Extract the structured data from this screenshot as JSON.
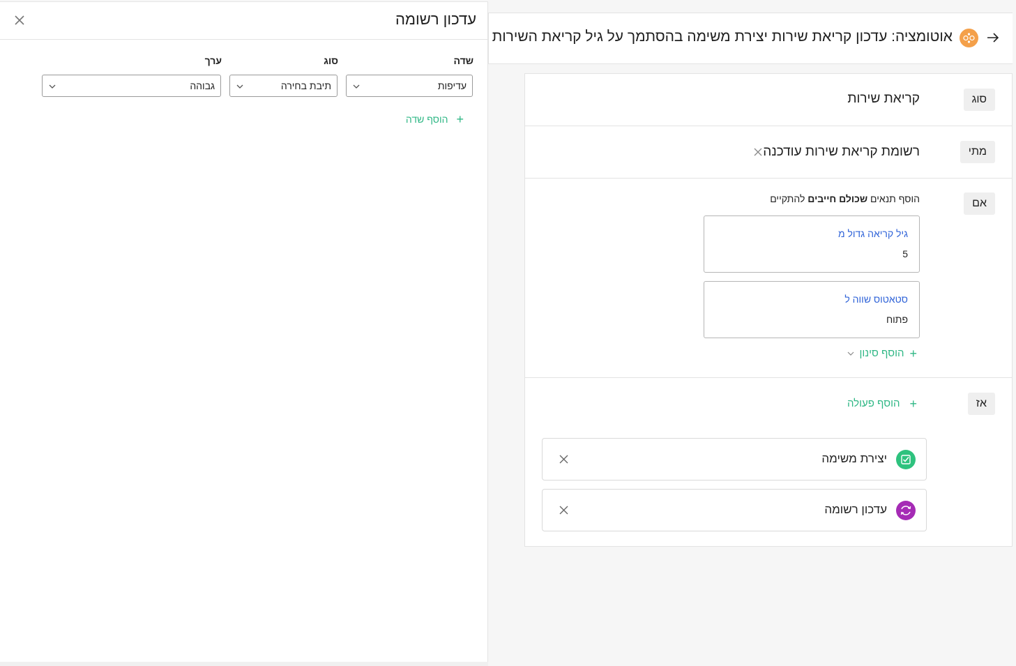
{
  "drawer": {
    "title": "עדכון רשומה",
    "labels": {
      "field": "שדה",
      "type": "סוג",
      "value": "ערך"
    },
    "row": {
      "field": "עדיפות",
      "type": "תיבת בחירה",
      "value": "גבוהה"
    },
    "add_field": "הוסף שדה"
  },
  "automation": {
    "title": "אוטומציה: עדכון קריאת שירות יצירת משימה בהסתמך על גיל קריאת השירות",
    "icon": "automation-icon",
    "icon_color": "#f4a04a",
    "type": {
      "chip": "סוג",
      "value": "קריאת שירות"
    },
    "when": {
      "chip": "מתי",
      "value": "רשומת קריאת שירות עודכנה"
    },
    "if": {
      "chip": "אם",
      "intro_prefix": "הוסף תנאים ",
      "intro_bold": "שכולם חייבים",
      "intro_suffix": " להתקיים",
      "conditions": [
        {
          "label": "גיל קריאה גדול מ",
          "value": "5"
        },
        {
          "label": "סטאטוס שווה ל",
          "value": "פתוח"
        }
      ],
      "add_filter": "הוסף סינון"
    },
    "then": {
      "chip": "אז",
      "add_action": "הוסף פעולה",
      "actions": [
        {
          "label": "יצירת משימה",
          "icon": "task-check-icon",
          "color": "#2ec27e"
        },
        {
          "label": "עדכון רשומה",
          "icon": "refresh-icon",
          "color": "#a52bb5"
        }
      ]
    }
  },
  "colors": {
    "accent_green": "#2fb785",
    "link_blue": "#2f63d8"
  }
}
